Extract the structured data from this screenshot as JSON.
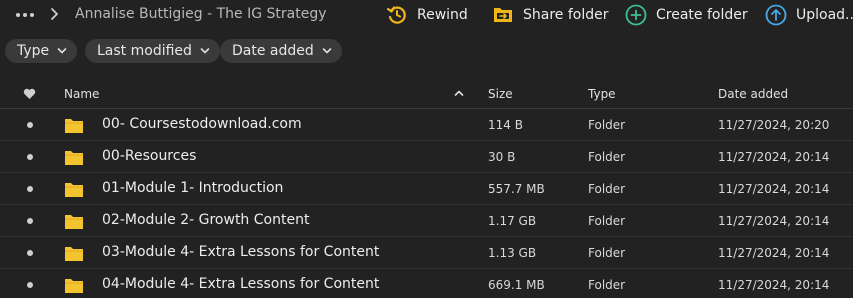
{
  "breadcrumb": {
    "path": "Annalise Buttigieg - The IG Strategy"
  },
  "toolbar": {
    "rewind_label": "Rewind",
    "share_label": "Share folder",
    "create_label": "Create folder",
    "upload_label": "Upload..."
  },
  "filters": {
    "type_label": "Type",
    "modified_label": "Last modified",
    "added_label": "Date added"
  },
  "table": {
    "columns": {
      "name": "Name",
      "size": "Size",
      "type": "Type",
      "date_added": "Date added"
    },
    "rows": [
      {
        "name": "00- Coursestodownload.com",
        "size": "114 B",
        "type": "Folder",
        "date_added": "11/27/2024, 20:20"
      },
      {
        "name": "00-Resources",
        "size": "30 B",
        "type": "Folder",
        "date_added": "11/27/2024, 20:14"
      },
      {
        "name": "01-Module 1- Introduction",
        "size": "557.7 MB",
        "type": "Folder",
        "date_added": "11/27/2024, 20:14"
      },
      {
        "name": "02-Module 2- Growth Content",
        "size": "1.17 GB",
        "type": "Folder",
        "date_added": "11/27/2024, 20:14"
      },
      {
        "name": "03-Module 4- Extra Lessons for Content",
        "size": "1.13 GB",
        "type": "Folder",
        "date_added": "11/27/2024, 20:14"
      },
      {
        "name": "04-Module 4- Extra Lessons for Content",
        "size": "669.1 MB",
        "type": "Folder",
        "date_added": "11/27/2024, 20:14"
      }
    ]
  },
  "icons": {
    "more": "more-dots-icon",
    "breadcrumb_separator": "chevron-right-icon",
    "rewind": "rewind-icon",
    "share": "share-folder-icon",
    "create": "create-folder-icon",
    "upload": "upload-icon",
    "favorite_column": "heart-icon",
    "sort": "sort-ascending-icon",
    "row_folder": "folder-icon"
  },
  "colors": {
    "background": "#222222",
    "chip": "#3a3a3a",
    "rewind": "#f2b51a",
    "share": "#f2b51a",
    "create": "#3fbf8f",
    "upload": "#4aa8e8",
    "folder": "#f4c430"
  }
}
